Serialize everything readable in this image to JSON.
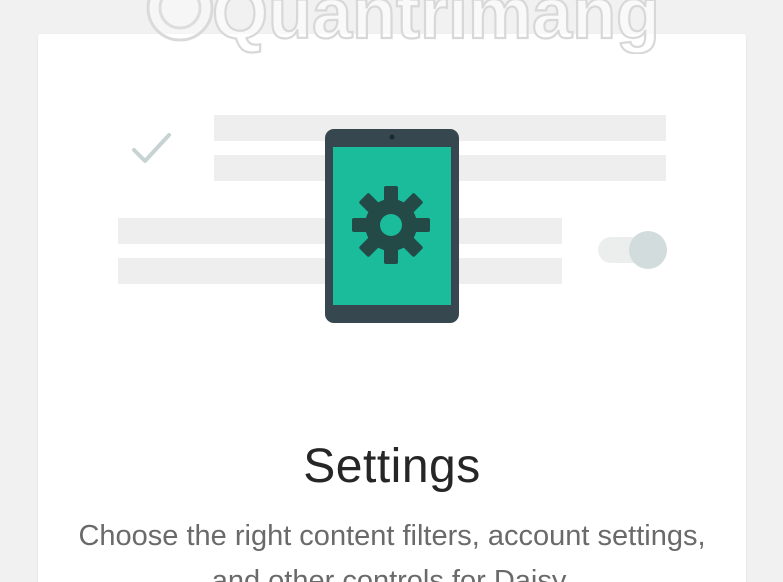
{
  "watermark": {
    "text": "Quantrimang"
  },
  "onboarding": {
    "illustration": {
      "check_icon": "checkmark-icon",
      "device_icon": "tablet-icon",
      "settings_icon": "gear-icon",
      "toggle_icon": "toggle-switch-icon"
    },
    "title": "Settings",
    "description": "Choose the right content filters, account settings, and other controls for Daisy."
  },
  "colors": {
    "page_background": "#f1f1f1",
    "card_background": "#ffffff",
    "placeholder_bar": "#eeeeee",
    "checkmark": "#c7d3d3",
    "tablet_frame": "#37474f",
    "tablet_screen": "#1abc9c",
    "gear": "#244a47",
    "toggle_track": "#eceeee",
    "toggle_knob": "#d3dcdc",
    "title_text": "#262626",
    "body_text": "#6a6a6a"
  }
}
